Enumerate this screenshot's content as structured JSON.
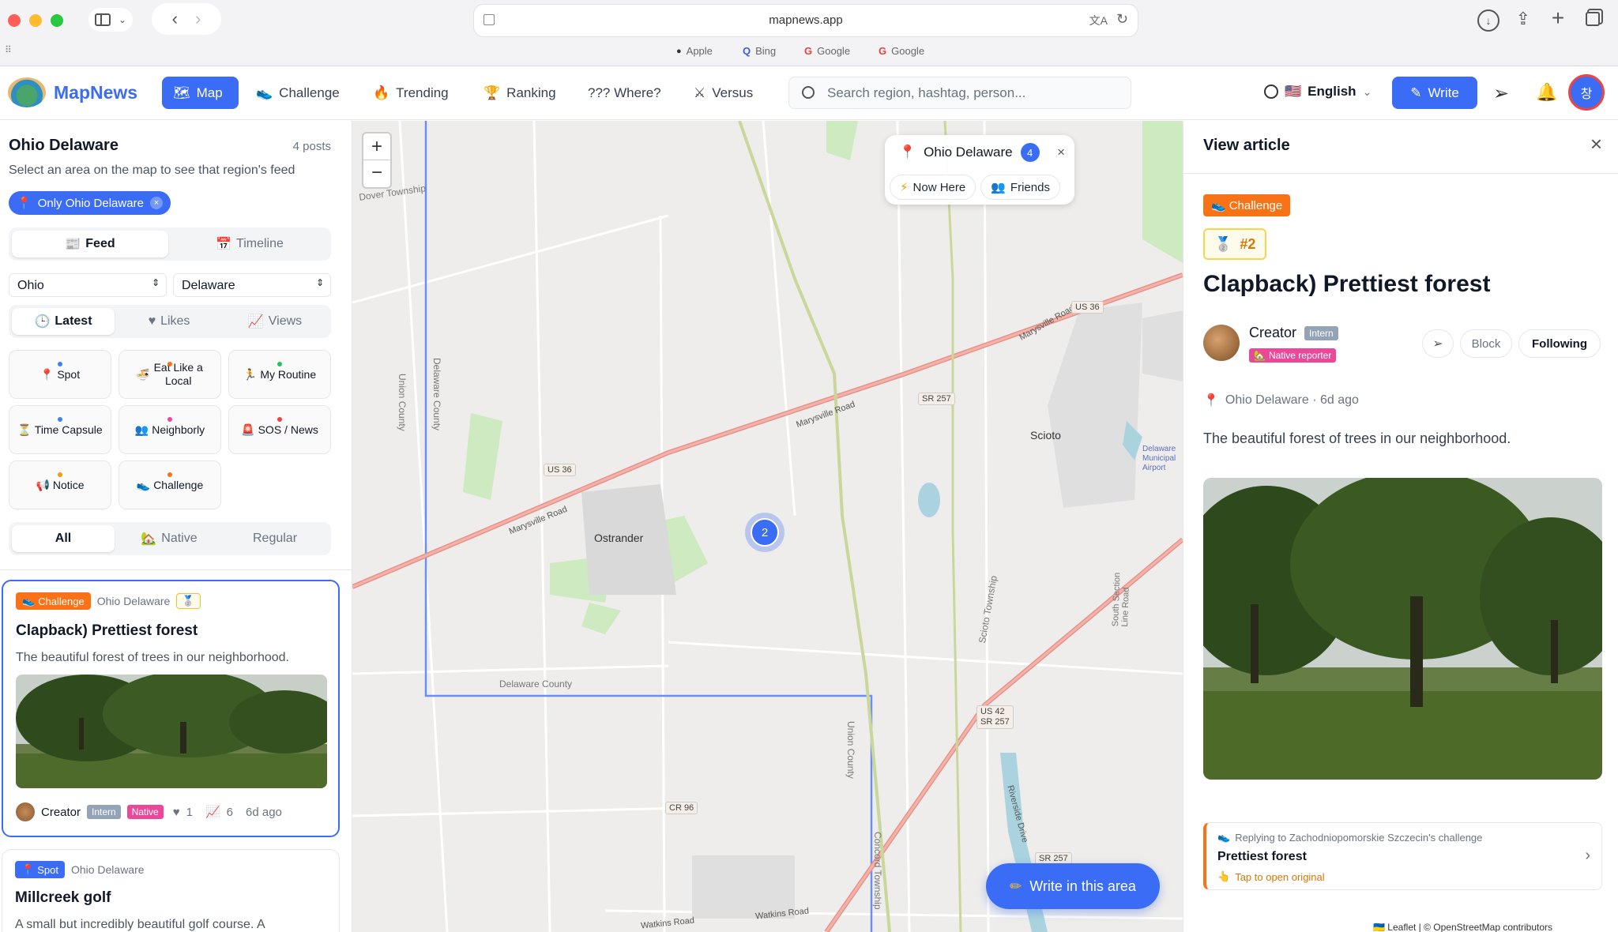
{
  "browser": {
    "url": "mapnews.app",
    "favorites": [
      "Apple",
      "Bing",
      "Google",
      "Google"
    ]
  },
  "header": {
    "logo": "MapNews",
    "nav": [
      {
        "label": "Map",
        "icon": "map-icon"
      },
      {
        "label": "Challenge",
        "icon": "sneaker-icon"
      },
      {
        "label": "Trending",
        "icon": "fire-icon"
      },
      {
        "label": "Ranking",
        "icon": "trophy-icon"
      },
      {
        "label": "??? Where?",
        "icon": ""
      },
      {
        "label": "Versus",
        "icon": "crossed-swords-icon"
      }
    ],
    "search_placeholder": "Search region, hashtag, person...",
    "language": "English",
    "write_label": "Write",
    "avatar_initial": "창"
  },
  "left": {
    "region_title": "Ohio Delaware",
    "post_count": "4 posts",
    "hint": "Select an area on the map to see that region's feed",
    "filter_chip": "Only Ohio Delaware",
    "view_tabs": [
      "Feed",
      "Timeline"
    ],
    "state_select": "Ohio",
    "county_select": "Delaware",
    "sort_tabs": [
      "Latest",
      "Likes",
      "Views"
    ],
    "categories": [
      {
        "label": "Spot",
        "dot": "#3b82f6"
      },
      {
        "label": "Eat Like a Local",
        "dot": "#f97316"
      },
      {
        "label": "My Routine",
        "dot": "#22c55e"
      },
      {
        "label": "Time Capsule",
        "dot": "#3b82f6"
      },
      {
        "label": "Neighborly",
        "dot": "#ec4899"
      },
      {
        "label": "SOS / News",
        "dot": "#ef4444"
      },
      {
        "label": "Notice",
        "dot": "#f59e0b"
      },
      {
        "label": "Challenge",
        "dot": "#f97316"
      }
    ],
    "author_tabs": [
      "All",
      "Native",
      "Regular"
    ],
    "posts": [
      {
        "category": "Challenge",
        "region": "Ohio Delaware",
        "title": "Clapback) Prettiest forest",
        "excerpt": "The beautiful forest of trees in our neighborhood.",
        "author": "Creator",
        "rank_tag": "Intern",
        "native_tag": "Native",
        "likes": "1",
        "views": "6",
        "time": "6d ago"
      },
      {
        "category": "Spot",
        "region": "Ohio Delaware",
        "title": "Millcreek golf",
        "excerpt": "A small but incredibly beautiful golf course. A"
      }
    ]
  },
  "map": {
    "popup_region": "Ohio Delaware",
    "popup_count": "4",
    "chips": [
      "Now Here",
      "Friends"
    ],
    "cluster_count": "2",
    "write_here": "Write in this area",
    "labels": {
      "dover": "Dover Township",
      "ostrander": "Ostrander",
      "scioto": "Scioto",
      "delaware_county": "Delaware County",
      "union_county": "Union County",
      "delaware_county_v": "Delaware County",
      "union_county_v": "Union County",
      "concord": "Concord Township",
      "scioto_twp": "Scioto Township",
      "south_section": "South Section Line Road",
      "maryville1": "Marysville Road",
      "maryville2": "Marysville Road",
      "maryville3": "Marysville Road",
      "watkins": "Watkins Road",
      "watkins2": "Watkins Road",
      "riverside": "Riverside Drive",
      "delaware_airport": "Delaware Municipal Airport",
      "us36a": "US 36",
      "us36b": "US 36",
      "sr257a": "SR 257",
      "us42": "US 42",
      "sr257b": "SR 257",
      "sr257c": "SR 257",
      "cr96": "CR 96"
    },
    "attribution": "Leaflet | © OpenStreetMap contributors"
  },
  "article": {
    "header": "View article",
    "category": "Challenge",
    "rank": "#2",
    "title": "Clapback) Prettiest forest",
    "author": "Creator",
    "rank_tag": "Intern",
    "reporter_tag": "Native reporter",
    "block": "Block",
    "following": "Following",
    "location": "Ohio Delaware · 6d ago",
    "body": "The beautiful forest of trees in our neighborhood.",
    "reply_prefix": "Replying to Zachodniopomorskie Szczecin's challenge",
    "reply_title": "Prettiest forest",
    "reply_hint": "Tap to open original"
  }
}
